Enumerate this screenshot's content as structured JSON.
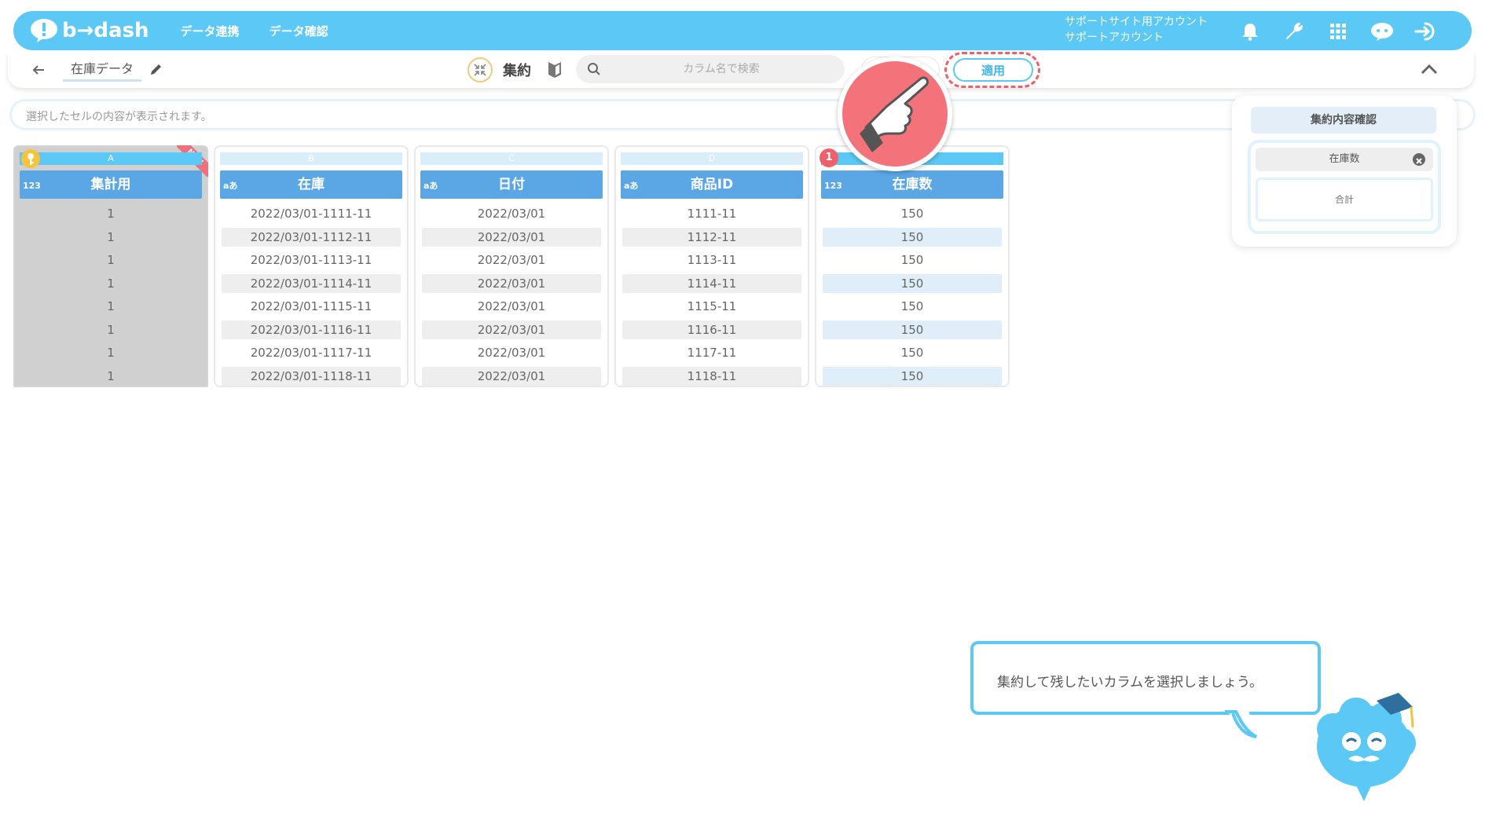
{
  "brand": {
    "logo_text": "b→dash",
    "accent": "#5bc8f5"
  },
  "nav": {
    "items": [
      "データ連携",
      "データ確認"
    ]
  },
  "account": {
    "line1": "サポートサイト用アカウント",
    "line2": "サポートアカウント"
  },
  "topbar_icons": [
    "bell-icon",
    "wrench-icon",
    "grid-icon",
    "chat-icon",
    "logout-icon"
  ],
  "subbar": {
    "table_name": "在庫データ",
    "mode_label": "集約",
    "search_placeholder": "カラム名で検索",
    "apply_label": "適用"
  },
  "cellbar": {
    "placeholder": "選択したセルの内容が表示されます。"
  },
  "columns": [
    {
      "letter": "A",
      "type": "123",
      "name": "集計用",
      "new": "NEW",
      "cells": [
        "1",
        "1",
        "1",
        "1",
        "1",
        "1",
        "1",
        "1"
      ]
    },
    {
      "letter": "B",
      "type": "aあ",
      "name": "在庫",
      "cells": [
        "2022/03/01-1111-11",
        "2022/03/01-1112-11",
        "2022/03/01-1113-11",
        "2022/03/01-1114-11",
        "2022/03/01-1115-11",
        "2022/03/01-1116-11",
        "2022/03/01-1117-11",
        "2022/03/01-1118-11"
      ]
    },
    {
      "letter": "C",
      "type": "aあ",
      "name": "日付",
      "cells": [
        "2022/03/01",
        "2022/03/01",
        "2022/03/01",
        "2022/03/01",
        "2022/03/01",
        "2022/03/01",
        "2022/03/01",
        "2022/03/01"
      ]
    },
    {
      "letter": "D",
      "type": "aあ",
      "name": "商品ID",
      "cells": [
        "1111-11",
        "1112-11",
        "1113-11",
        "1114-11",
        "1115-11",
        "1116-11",
        "1117-11",
        "1118-11"
      ]
    },
    {
      "letter": "",
      "type": "123",
      "name": "在庫数",
      "badge": "1",
      "cells": [
        "150",
        "150",
        "150",
        "150",
        "150",
        "150",
        "150",
        "150"
      ]
    }
  ],
  "panel": {
    "title": "集約内容確認",
    "item": "在庫数",
    "aggregation": "合計"
  },
  "bubble": {
    "text": "集約して残したいカラムを選択しましょう。"
  }
}
